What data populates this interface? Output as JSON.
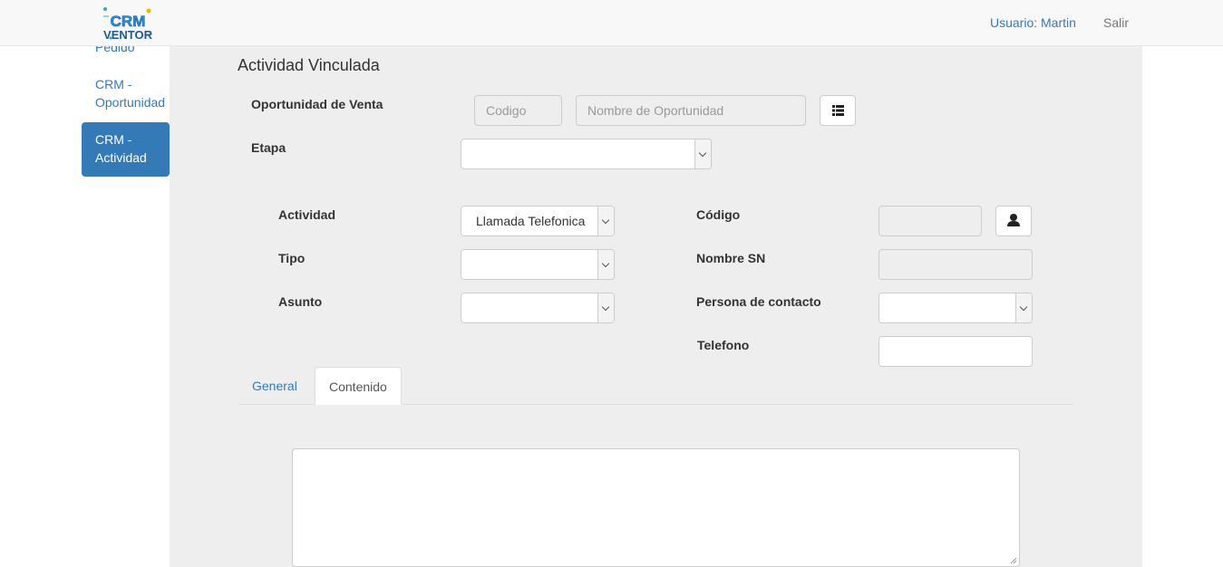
{
  "header": {
    "logo_top": "CRM",
    "logo_bottom": "VENTOR",
    "user_label": "Usuario: Martin",
    "logout_label": "Salir"
  },
  "sidebar": {
    "items": [
      {
        "label": "Pedido",
        "partial": true
      },
      {
        "label": "CRM - Oportunidad",
        "line1": "CRM -",
        "line2": "Oportunidad"
      },
      {
        "label": "CRM - Actividad",
        "line1": "CRM -",
        "line2": "Actividad",
        "active": true
      }
    ]
  },
  "form": {
    "section_title": "Actividad Vinculada",
    "oportunidad_label": "Oportunidad de Venta",
    "codigo_placeholder": "Codigo",
    "nombre_oportunidad_placeholder": "Nombre de Oportunidad",
    "etapa_label": "Etapa",
    "etapa_value": "",
    "actividad_label": "Actividad",
    "actividad_value": "Llamada Telefonica",
    "tipo_label": "Tipo",
    "tipo_value": "",
    "asunto_label": "Asunto",
    "asunto_value": "",
    "codigo_label": "Código",
    "codigo_value": "",
    "nombre_sn_label": "Nombre SN",
    "nombre_sn_value": "",
    "persona_contacto_label": "Persona de contacto",
    "persona_contacto_value": "",
    "telefono_label": "Telefono",
    "telefono_value": ""
  },
  "tabs": [
    {
      "label": "General",
      "active": false
    },
    {
      "label": "Contenido",
      "active": true
    }
  ],
  "content": {
    "textarea_value": ""
  },
  "icons": {
    "list_button": "list-icon",
    "user_button": "user-icon"
  },
  "colors": {
    "accent": "#337ab7",
    "panel_bg": "#eeeeee",
    "navbar_bg": "#f8f8f8"
  }
}
